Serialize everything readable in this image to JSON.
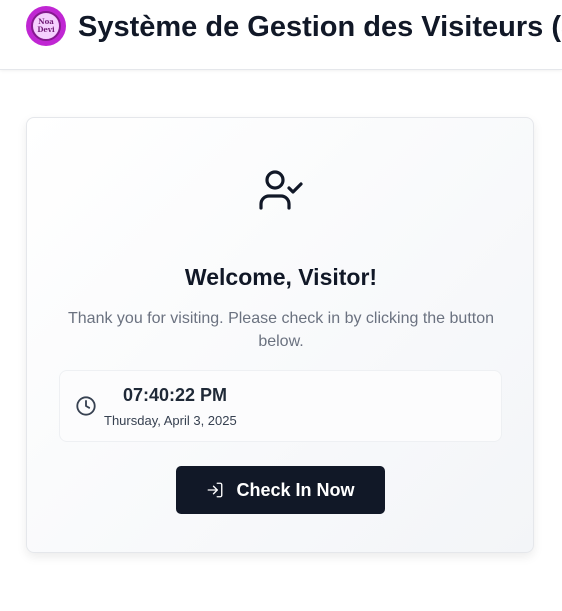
{
  "header": {
    "logo_top_text": "Noa",
    "logo_bottom_text": "Devi",
    "title": "Système de Gestion des Visiteurs (S"
  },
  "card": {
    "icon": "user-check-icon",
    "welcome": "Welcome, Visitor!",
    "subtitle": "Thank you for visiting. Please check in by clicking the button below.",
    "clock": {
      "icon": "clock-icon",
      "time": "07:40:22 PM",
      "date": "Thursday, April 3, 2025"
    },
    "button": {
      "icon": "log-in-icon",
      "label": "Check In Now"
    }
  },
  "colors": {
    "primary_dark": "#111827",
    "muted_text": "#6b7280",
    "logo_magenta": "#c026d3"
  }
}
